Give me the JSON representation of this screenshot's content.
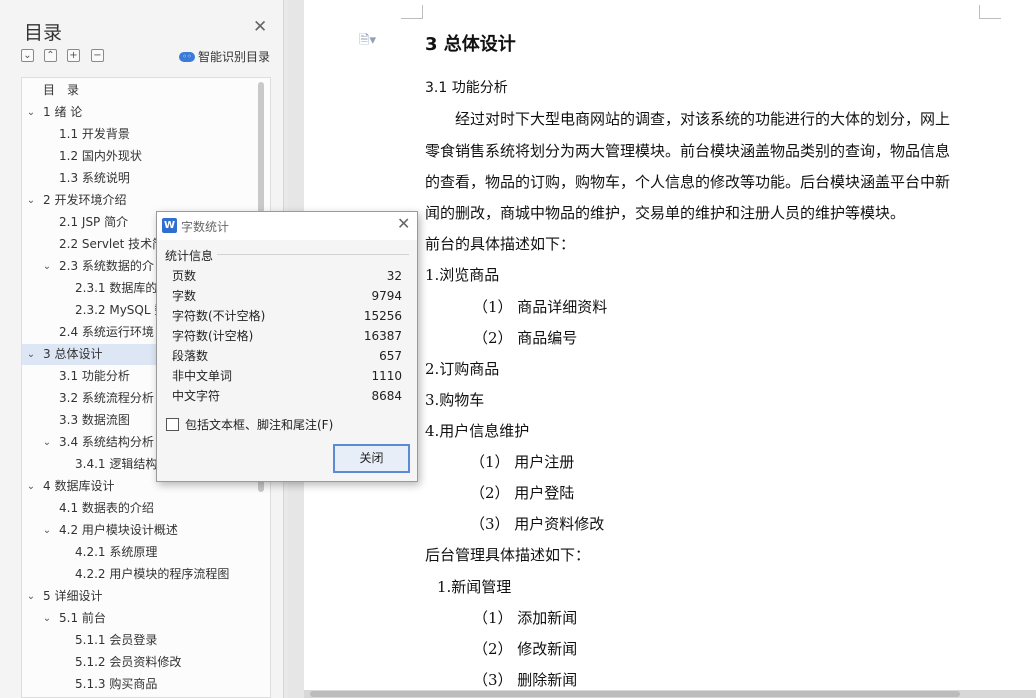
{
  "toc": {
    "title": "目录",
    "smart_toc_label": "智能识别目录",
    "tools": [
      "collapse-all",
      "collapse",
      "expand",
      "remove"
    ],
    "items": [
      {
        "label": "目　录",
        "level": 1,
        "chevron": ""
      },
      {
        "label": "1  绪  论",
        "level": 1,
        "chevron": "down"
      },
      {
        "label": "1.1  开发背景",
        "level": 2,
        "chevron": ""
      },
      {
        "label": "1.2  国内外现状",
        "level": 2,
        "chevron": ""
      },
      {
        "label": "1.3  系统说明",
        "level": 2,
        "chevron": ""
      },
      {
        "label": "2  开发环境介绍",
        "level": 1,
        "chevron": "down"
      },
      {
        "label": "2.1 JSP 简介",
        "level": 2,
        "chevron": ""
      },
      {
        "label": "2.2 Servlet 技术简",
        "level": 2,
        "chevron": ""
      },
      {
        "label": "2.3  系统数据的介",
        "level": 2,
        "chevron": "down"
      },
      {
        "label": "2.3.1  数据库的",
        "level": 3,
        "chevron": ""
      },
      {
        "label": "2.3.2 MySQL 数",
        "level": 3,
        "chevron": ""
      },
      {
        "label": "2.4  系统运行环境",
        "level": 2,
        "chevron": ""
      },
      {
        "label": "3  总体设计",
        "level": 1,
        "chevron": "down",
        "selected": true
      },
      {
        "label": "3.1  功能分析",
        "level": 2,
        "chevron": ""
      },
      {
        "label": "3.2 系统流程分析",
        "level": 2,
        "chevron": ""
      },
      {
        "label": "3.3  数据流图",
        "level": 2,
        "chevron": ""
      },
      {
        "label": "3.4  系统结构分析",
        "level": 2,
        "chevron": "down"
      },
      {
        "label": "3.4.1  逻辑结构",
        "level": 3,
        "chevron": ""
      },
      {
        "label": "4  数据库设计",
        "level": 1,
        "chevron": "down"
      },
      {
        "label": "4.1  数据表的介绍",
        "level": 2,
        "chevron": ""
      },
      {
        "label": "4.2  用户模块设计概述",
        "level": 2,
        "chevron": "down"
      },
      {
        "label": "4.2.1  系统原理",
        "level": 3,
        "chevron": ""
      },
      {
        "label": "4.2.2  用户模块的程序流程图",
        "level": 3,
        "chevron": ""
      },
      {
        "label": "5  详细设计",
        "level": 1,
        "chevron": "down"
      },
      {
        "label": "5.1  前台",
        "level": 2,
        "chevron": "down"
      },
      {
        "label": "5.1.1  会员登录",
        "level": 3,
        "chevron": ""
      },
      {
        "label": "5.1.2  会员资料修改",
        "level": 3,
        "chevron": ""
      },
      {
        "label": "5.1.3  购买商品",
        "level": 3,
        "chevron": ""
      }
    ]
  },
  "document": {
    "heading": "3  总体设计",
    "subheading": "3.1  功能分析",
    "lines": [
      "　　经过对时下大型电商网站的调查，对该系统的功能进行的大体的划分，网上",
      "零食销售系统将划分为两大管理模块。前台模块涵盖物品类别的查询，物品信息",
      "的查看，物品的订购，购物车，个人信息的修改等功能。后台模块涵盖平台中新",
      "闻的删改，商城中物品的维护，交易单的维护和注册人员的维护等模块。",
      "前台的具体描述如下：",
      "1.浏览商品",
      "（1）  商品详细资料",
      "（2）  商品编号",
      "2.订购商品",
      "3.购物车",
      "4.用户信息维护",
      "（1）  用户注册",
      "（2）  用户登陆",
      "（3）  用户资料修改",
      "后台管理具体描述如下：",
      "1.新闻管理",
      "（1）  添加新闻",
      "（2）  修改新闻",
      "（3）  删除新闻"
    ]
  },
  "word_count_dialog": {
    "title": "字数统计",
    "section_label": "统计信息",
    "stats": [
      {
        "label": "页数",
        "value": "32"
      },
      {
        "label": "字数",
        "value": "9794"
      },
      {
        "label": "字符数(不计空格)",
        "value": "15256"
      },
      {
        "label": "字符数(计空格)",
        "value": "16387"
      },
      {
        "label": "段落数",
        "value": "657"
      },
      {
        "label": "非中文单词",
        "value": "1110"
      },
      {
        "label": "中文字符",
        "value": "8684"
      }
    ],
    "checkbox_label": "包括文本框、脚注和尾注(F)",
    "checkbox_checked": false,
    "close_button": "关闭"
  }
}
